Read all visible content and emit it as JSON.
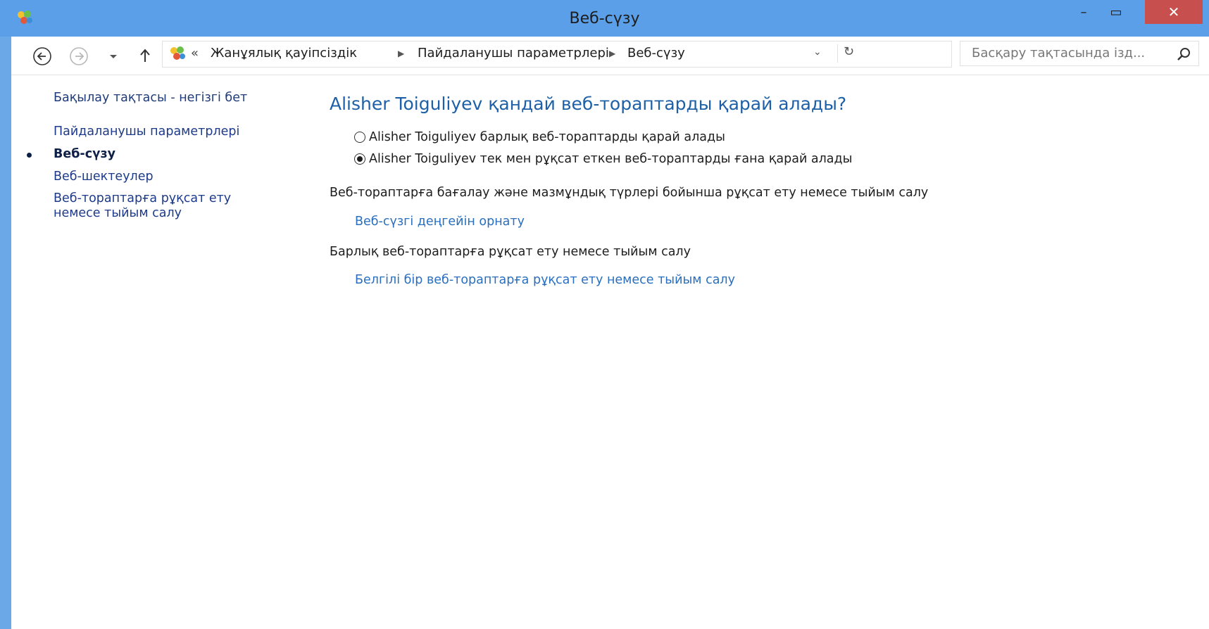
{
  "window": {
    "title": "Веб-сүзу",
    "minimize_label": "–",
    "maximize_label": "▭",
    "close_label": "✕"
  },
  "navbar": {
    "breadcrumb": [
      "Жанұялық қауіпсіздік",
      "Пайдаланушы параметрлері",
      "Веб-сүзу"
    ],
    "breadcrumb_overflow": "«",
    "search_placeholder": "Басқару тақтасында ізд..."
  },
  "sidebar": {
    "items": [
      {
        "label": "Бақылау тақтасы - негізгі бет"
      },
      {
        "label": "Пайдаланушы параметрлері"
      },
      {
        "label": "Веб-сүзу",
        "current": true
      },
      {
        "label": "Веб-шектеулер"
      },
      {
        "label": "Веб-торап тарға рұқсат ету немесе тыйым салу"
      }
    ]
  },
  "main": {
    "heading": "Alisher Toiguliyev қандай веб-тораптарды қарай алады?",
    "options": [
      {
        "label": "Alisher Toiguliyev барлық веб-тораптарды қарай алады",
        "selected": false
      },
      {
        "label": "Alisher Toiguliyev тек мен рұқсат еткен веб-тораптарды ғана қарай алады",
        "selected": true
      }
    ],
    "section1_text": "Веб-тораптарға бағалау және мазмұндық түрлері бойынша рұқсат ету немесе тыйым салу",
    "section1_link": "Веб-сүзгі деңгейін орнату",
    "section2_text": "Барлық веб-тораптарға рұқсат ету немесе тыйым салу",
    "section2_link": "Белгілі бір веб-тораптарға рұқсат ету немесе тыйым салу"
  },
  "colors": {
    "title_bar": "#5a9fe8",
    "close_button": "#c7504e",
    "link": "#2a6fbf",
    "heading": "#1e60a8"
  }
}
